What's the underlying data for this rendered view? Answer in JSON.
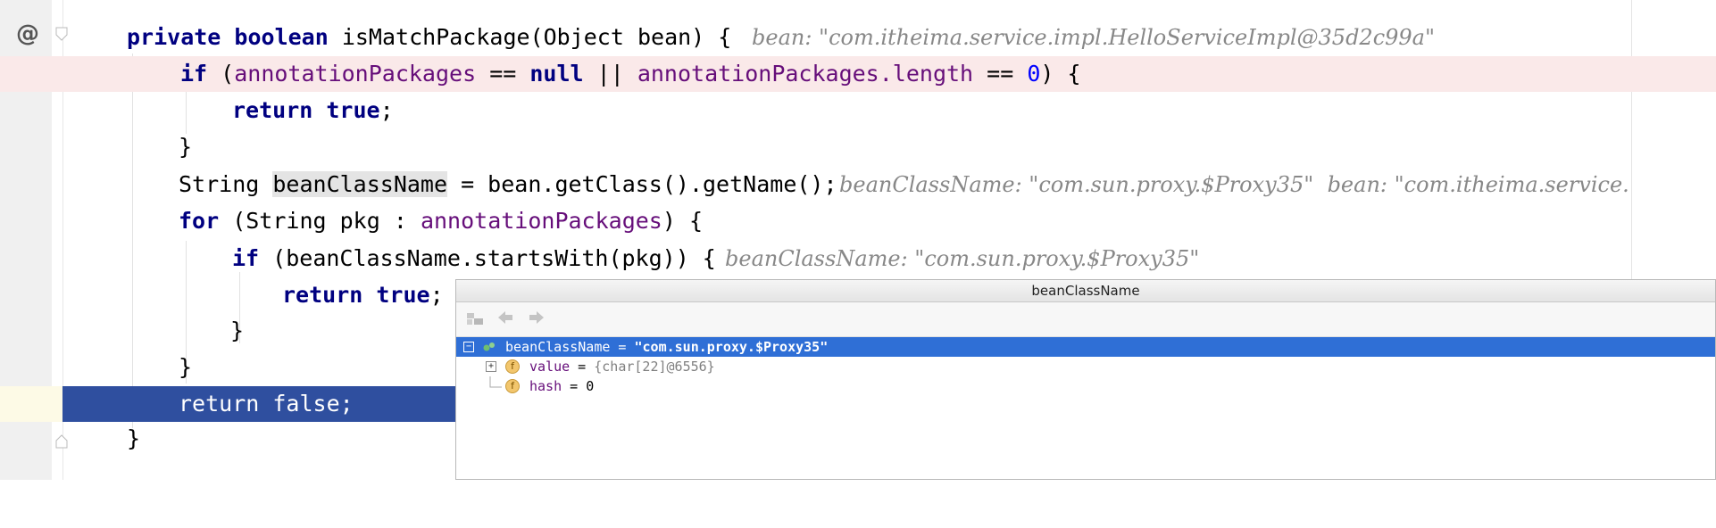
{
  "gutter": {
    "at_icon": "@"
  },
  "code": {
    "l1": {
      "kw1": "private",
      "kw2": "boolean",
      "rest": " isMatchPackage(Object bean) {",
      "hint": "bean: \"com.itheima.service.impl.HelloServiceImpl@35d2c99a\""
    },
    "l2": {
      "kw": "if",
      "p1": " (",
      "f1": "annotationPackages",
      "op": " == ",
      "kwnull": "null",
      "or": " || ",
      "f2": "annotationPackages",
      "len": ".length",
      "op2": " == ",
      "zero": "0",
      "end": ") {"
    },
    "l3": {
      "kw": "return",
      "kw2": "true",
      "end": ";"
    },
    "l4": {
      "text": "}"
    },
    "l5": {
      "t1": "String ",
      "var": "beanClassName",
      "t2": " = bean.getClass().getName();",
      "hint": "beanClassName: \"com.sun.proxy.$Proxy35\"  bean: \"com.itheima.service."
    },
    "l6": {
      "kw": "for",
      "t1": " (String pkg : ",
      "f1": "annotationPackages",
      "t2": ") {"
    },
    "l7": {
      "kw": "if",
      "t1": " (beanClassName.startsWith(pkg)) {",
      "hint": "beanClassName: \"com.sun.proxy.$Proxy35\""
    },
    "l8": {
      "kw": "return",
      "kw2": "true",
      "end": ";"
    },
    "l9": {
      "text": "}"
    },
    "l10": {
      "text": "}"
    },
    "l11": {
      "kw": "return",
      "kw2": "false",
      "end": ";"
    },
    "l12": {
      "text": "}"
    }
  },
  "popup": {
    "title": "beanClassName",
    "root": {
      "expander": "−",
      "name": "beanClassName",
      "eq": " = ",
      "value": "\"com.sun.proxy.$Proxy35\""
    },
    "child1": {
      "expander": "+",
      "badge": "f",
      "name": "value",
      "eq": " = ",
      "value": "{char[22]@6556}"
    },
    "child2": {
      "badge": "f",
      "name": "hash",
      "eq": " = ",
      "value": "0"
    }
  },
  "colors": {
    "keyword": "#000080",
    "field": "#660e7a",
    "number": "#0000ff",
    "breakpoint_line": "#fae9e9",
    "execution_line": "#2f4f9f",
    "selection": "#2f6fd6"
  }
}
